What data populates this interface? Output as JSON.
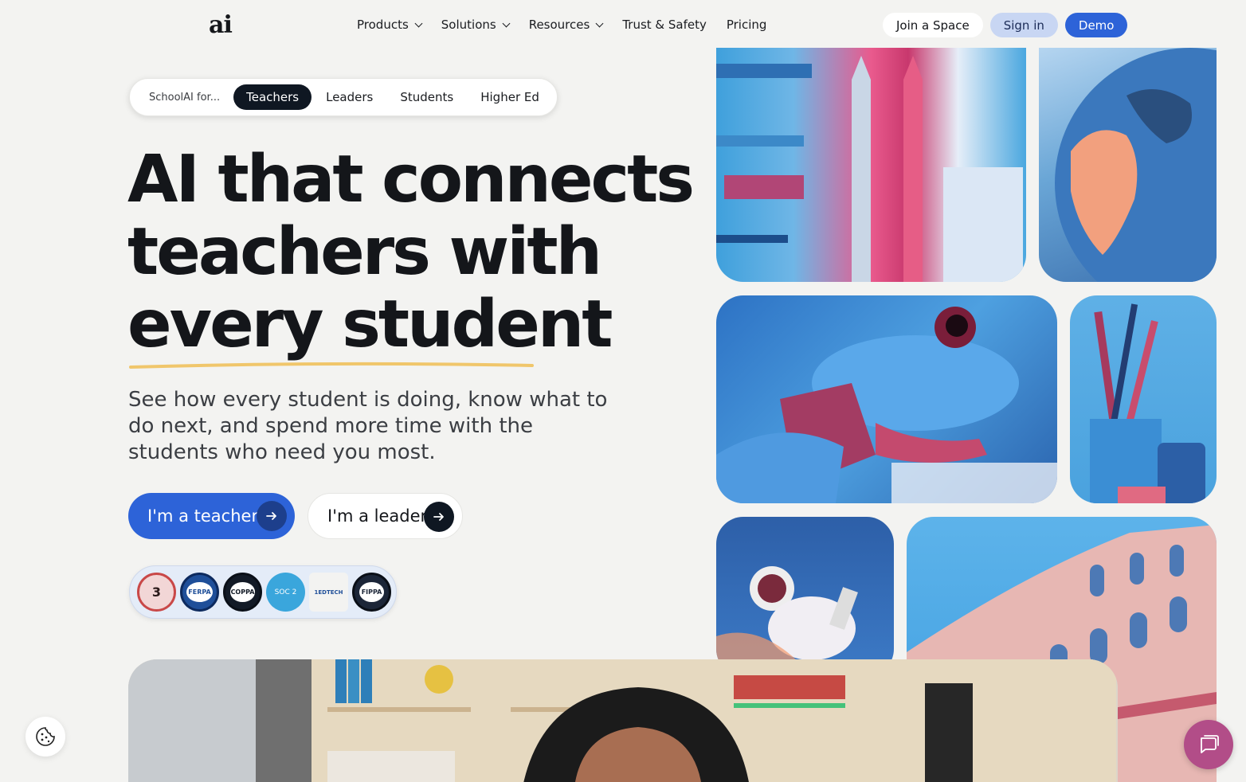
{
  "brand": {
    "logo_text": "ai"
  },
  "nav": {
    "items": [
      {
        "label": "Products",
        "has_dropdown": true
      },
      {
        "label": "Solutions",
        "has_dropdown": true
      },
      {
        "label": "Resources",
        "has_dropdown": true
      },
      {
        "label": "Trust & Safety",
        "has_dropdown": false
      },
      {
        "label": "Pricing",
        "has_dropdown": false
      }
    ],
    "join_label": "Join a Space",
    "signin_label": "Sign in",
    "demo_label": "Demo"
  },
  "segment": {
    "prefix": "SchoolAI for...",
    "tabs": [
      {
        "label": "Teachers",
        "active": true
      },
      {
        "label": "Leaders",
        "active": false
      },
      {
        "label": "Students",
        "active": false
      },
      {
        "label": "Higher Ed",
        "active": false
      }
    ]
  },
  "hero": {
    "title_line1": "AI that connects",
    "title_line2": "teachers with",
    "title_line3": "every student",
    "subtitle": "See how every student is doing, know what to do next, and spend more time with the students who need you most."
  },
  "cta": {
    "teacher_label": "I'm a teacher",
    "leader_label": "I'm a leader"
  },
  "badges": [
    {
      "label": "3",
      "icon": "essa-level-3-badge"
    },
    {
      "label": "FERPA",
      "icon": "ferpa-badge"
    },
    {
      "label": "COPPA",
      "icon": "coppa-badge"
    },
    {
      "label": "SOC 2",
      "icon": "aicpa-soc2-badge"
    },
    {
      "label": "1EDTECH",
      "icon": "1edtech-certified-badge"
    },
    {
      "label": "FIPPA",
      "icon": "fippa-badge"
    }
  ],
  "images": [
    {
      "name": "pencils-image"
    },
    {
      "name": "globe-image"
    },
    {
      "name": "frog-image"
    },
    {
      "name": "brushes-cup-image"
    },
    {
      "name": "astronaut-image"
    },
    {
      "name": "colosseum-image"
    }
  ],
  "colors": {
    "primary": "#2d63d8",
    "dark": "#0f1722",
    "background": "#f3f3f1",
    "chat": "#b24d88",
    "underline": "#f0c66b"
  }
}
